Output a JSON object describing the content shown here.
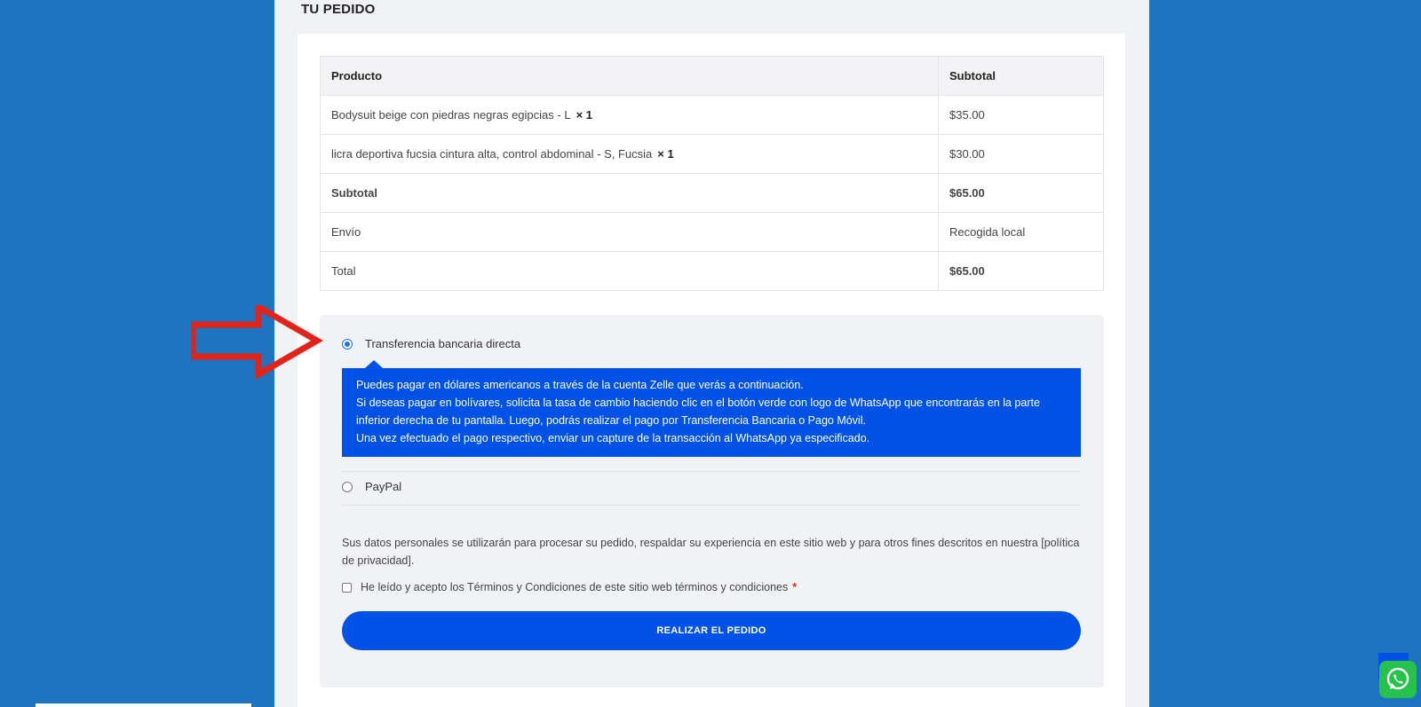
{
  "section_title": "TU PEDIDO",
  "order_table": {
    "headers": {
      "product": "Producto",
      "subtotal": "Subtotal"
    },
    "items": [
      {
        "name": "Bodysuit beige con piedras negras egipcias - L",
        "qty": "× 1",
        "price": "$35.00"
      },
      {
        "name": "licra deportiva fucsia cintura alta, control abdominal - S, Fucsia",
        "qty": "× 1",
        "price": "$30.00"
      }
    ],
    "subtotal": {
      "label": "Subtotal",
      "value": "$65.00"
    },
    "shipping": {
      "label": "Envío",
      "value": "Recogida local"
    },
    "total": {
      "label": "Total",
      "value": "$65.00"
    }
  },
  "payment": {
    "methods": [
      {
        "label": "Transferencia bancaria directa",
        "selected": true
      },
      {
        "label": "PayPal",
        "selected": false
      }
    ],
    "bank_description": [
      "Puedes pagar en dólares americanos a través de la cuenta Zelle que verás a continuación.",
      "Si deseas pagar en bolívares, solicita la tasa de cambio haciendo clic en el botón verde con logo de WhatsApp que encontrarás en la parte inferior derecha de tu pantalla. Luego, podrás realizar el pago por Transferencia Bancaria o Pago Móvil.",
      "Una vez efectuado el pago respectivo, enviar un capture de la transacción al WhatsApp ya especificado."
    ]
  },
  "privacy_text": "Sus datos personales se utilizarán para procesar su pedido, respaldar su experiencia en este sitio web y para otros fines descritos en nuestra [política de privacidad].",
  "terms": {
    "label": "He leído y acepto los Términos y Condiciones de este sitio web términos y condiciones",
    "required_mark": "*"
  },
  "place_order_label": "REALIZAR EL PEDIDO",
  "colors": {
    "page_bg": "#1f74c0",
    "accent": "#0052e6",
    "arrow": "#e2231a",
    "whatsapp": "#26c24b"
  },
  "icons": [
    "red-arrow-annotation",
    "whatsapp-icon",
    "scroll-top-icon"
  ]
}
